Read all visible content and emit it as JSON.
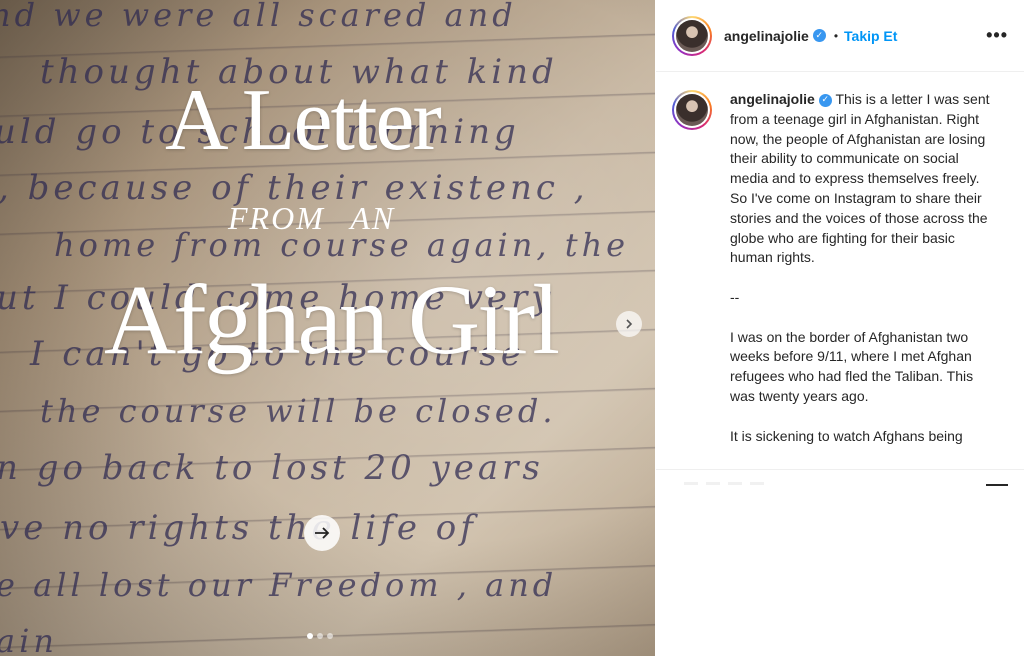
{
  "post": {
    "media": {
      "title_line1": "A Letter",
      "title_line2": "FROM  AN",
      "title_line3": "Afghan Girl",
      "handwriting": [
        "nd   we   were   all   scared   and",
        "thought   about   what   kind",
        "uld  go  to  school  morning",
        ", because  of  their  existenc ,",
        "home  from  course  again,  the",
        "ut  I  could  come  home  very",
        "I  can't  go  to  the  course",
        "the  course  will  be  closed.",
        "n  go  back  to  lost  20  years",
        "ve   no  rights  the  life  of",
        "e  all  lost  our  Freedom ,  and",
        "ain"
      ],
      "carousel": {
        "count": 3,
        "active_index": 0
      }
    },
    "header": {
      "username": "angelinajolie",
      "separator": "•",
      "follow_label": "Takip Et",
      "more_label": "•••"
    },
    "caption": {
      "username": "angelinajolie",
      "paragraphs": [
        "This is a letter I was sent from a teenage girl in Afghanistan. Right now, the people of Afghanistan are losing their ability to communicate on social media and to express themselves freely. So I've come on Instagram to share their stories and the voices of those across the globe who are fighting for their basic human rights.",
        "--",
        "I was on the border of Afghanistan two weeks before 9/11, where I met Afghan refugees who had fled the Taliban. This was twenty years ago.",
        "It is sickening to watch Afghans being"
      ]
    }
  },
  "colors": {
    "follow_blue": "#0095f6",
    "verified_blue": "#3897f0",
    "text": "#262626"
  },
  "icons": [
    "verified-badge-icon",
    "chevron-right-icon",
    "arrow-right-icon",
    "more-options-icon"
  ]
}
